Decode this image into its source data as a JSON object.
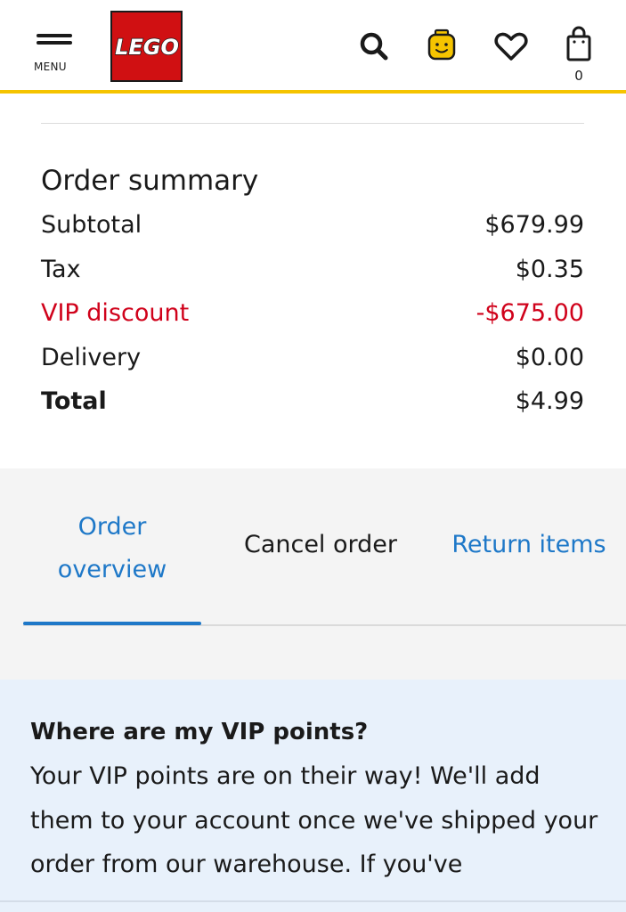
{
  "header": {
    "menu_label": "MENU",
    "logo_text": "LEGO",
    "bag_count": "0",
    "accent_color": "#f5c400",
    "brand_color": "#d01012",
    "icons": [
      "menu-icon",
      "search-icon",
      "vip-minifig-icon",
      "heart-icon",
      "shopping-bag-icon"
    ]
  },
  "summary": {
    "title": "Order summary",
    "rows": [
      {
        "label": "Subtotal",
        "value": "$679.99"
      },
      {
        "label": "Tax",
        "value": "$0.35"
      },
      {
        "label": "VIP discount",
        "value": "-$675.00"
      },
      {
        "label": "Delivery",
        "value": "$0.00"
      },
      {
        "label": "Total",
        "value": "$4.99"
      }
    ],
    "discount_color": "#d0021b"
  },
  "tabs": {
    "overview_line1": "Order",
    "overview_line2": "overview",
    "cancel": "Cancel order",
    "return": "Return items",
    "active": "Order overview",
    "link_color": "#1e78c8"
  },
  "vip_info": {
    "title": "Where are my VIP points?",
    "body": "Your VIP points are on their way! We'll add them to your account once we've shipped your order from our warehouse. If you've"
  }
}
